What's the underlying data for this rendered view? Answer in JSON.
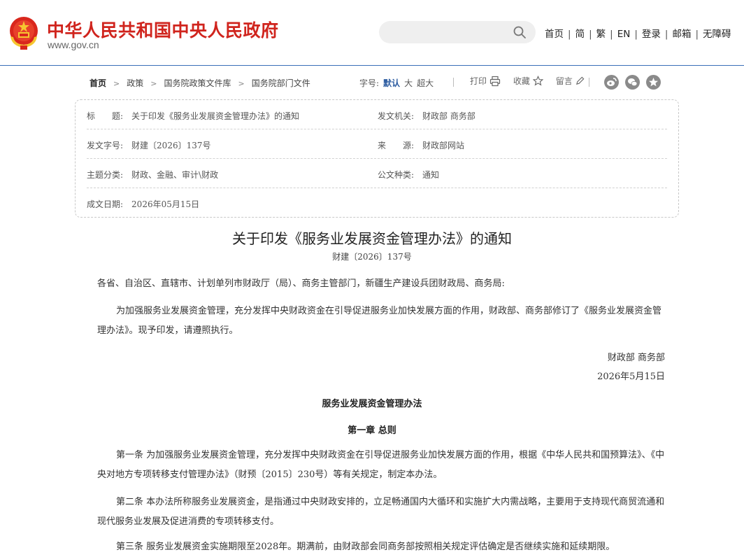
{
  "header": {
    "site_name": "中华人民共和国中央人民政府",
    "site_url": "www.gov.cn",
    "search_placeholder": "",
    "nav": [
      "首页",
      "简",
      "繁",
      "EN",
      "登录",
      "邮箱",
      "无障碍"
    ],
    "colors": {
      "brand_red": "#d0241d",
      "accent_blue": "#2b5ba0"
    }
  },
  "breadcrumb": [
    "首页",
    "政策",
    "国务院政策文件库",
    "国务院部门文件"
  ],
  "font_size": {
    "label": "字号:",
    "options": [
      "默认",
      "大",
      "超大"
    ],
    "selected": "默认"
  },
  "tools": {
    "print": "打印",
    "favorite": "收藏",
    "comment": "留言"
  },
  "share_icons": [
    "weibo-icon",
    "wechat-icon",
    "favorite-star-icon"
  ],
  "meta": {
    "title_key": "标　　题:",
    "title_val": "关于印发《服务业发展资金管理办法》的通知",
    "issuer_key": "发文机关:",
    "issuer_val": "财政部 商务部",
    "docno_key": "发文字号:",
    "docno_val": "财建〔2026〕137号",
    "source_key": "来　　源:",
    "source_val": "财政部网站",
    "topic_key": "主题分类:",
    "topic_val": "财政、金融、审计\\财政",
    "kind_key": "公文种类:",
    "kind_val": "通知",
    "date_key": "成文日期:",
    "date_val": "2026年05月15日"
  },
  "article": {
    "title": "关于印发《服务业发展资金管理办法》的通知",
    "number": "财建〔2026〕137号",
    "salutation": "各省、自治区、直辖市、计划单列市财政厅（局）、商务主管部门，新疆生产建设兵团财政局、商务局:",
    "body": "为加强服务业发展资金管理，充分发挥中央财政资金在引导促进服务业加快发展方面的作用，财政部、商务部修订了《服务业发展资金管理办法》。现予印发，请遵照执行。",
    "signature": "财政部 商务部",
    "date": "2026年5月15日",
    "sub_title": "服务业发展资金管理办法",
    "chapter": "第一章 总则",
    "article1": "第一条 为加强服务业发展资金管理，充分发挥中央财政资金在引导促进服务业加快发展方面的作用，根据《中华人民共和国预算法》、《中央对地方专项转移支付管理办法》（财预〔2015〕230号）等有关规定，制定本办法。",
    "article2": "第二条 本办法所称服务业发展资金，是指通过中央财政安排的，立足畅通国内大循环和实施扩大内需战略，主要用于支持现代商贸流通和现代服务业发展及促进消费的专项转移支付。",
    "article3": "第三条 服务业发展资金实施期限至2028年。期满前，由财政部会同商务部按照相关规定评估确定是否继续实施和延续期限。"
  }
}
